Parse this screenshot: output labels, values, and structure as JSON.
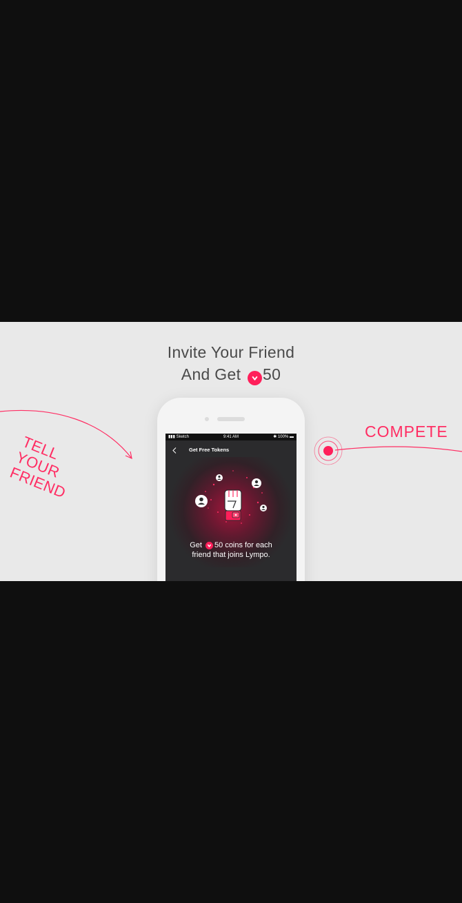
{
  "headline": {
    "line1": "Invite Your Friend",
    "line2_prefix": "And Get",
    "line2_amount": "50"
  },
  "side_labels": {
    "tell": [
      "TELL",
      "YOUR",
      "FRIEND"
    ],
    "compete": "COMPETE"
  },
  "phone": {
    "status": {
      "carrier": "Sketch",
      "time": "9:41 AM",
      "battery": "100%"
    },
    "nav_title": "Get Free Tokens",
    "message": {
      "prefix": "Get",
      "amount": "50",
      "suffix": "coins for each",
      "line2": "friend that joins Lympo."
    }
  },
  "colors": {
    "accent": "#ff2d63",
    "band_bg": "#e9e9e9",
    "outer_bg": "#0f0f0f",
    "screen_bg": "#2b2b2d"
  },
  "icons": [
    "coin-icon",
    "back-chevron-icon",
    "fist-icon",
    "friend-avatar-icon",
    "target-pulse-icon",
    "arrow-icon"
  ]
}
